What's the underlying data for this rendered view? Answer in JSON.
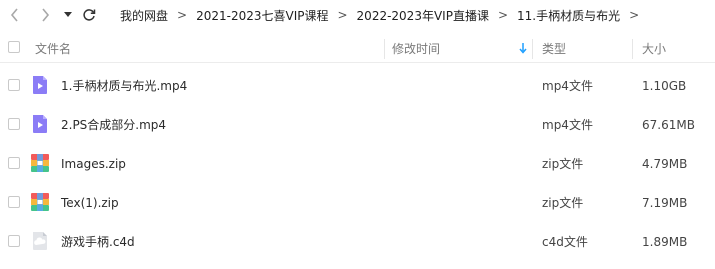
{
  "toolbar": {
    "breadcrumb": [
      "我的网盘",
      "2021-2023七喜VIP课程",
      "2022-2023年VIP直播课",
      "11.手柄材质与布光"
    ],
    "separator": ">"
  },
  "table": {
    "headers": {
      "name": "文件名",
      "modified": "修改时间",
      "type": "类型",
      "size": "大小"
    },
    "rows": [
      {
        "name": "1.手柄材质与布光.mp4",
        "type": "mp4文件",
        "size": "1.10GB",
        "icon": "video-file-icon"
      },
      {
        "name": "2.PS合成部分.mp4",
        "type": "mp4文件",
        "size": "67.61MB",
        "icon": "video-file-icon"
      },
      {
        "name": "Images.zip",
        "type": "zip文件",
        "size": "4.79MB",
        "icon": "zip-archive-icon"
      },
      {
        "name": "Tex(1).zip",
        "type": "zip文件",
        "size": "7.19MB",
        "icon": "zip-archive-icon"
      },
      {
        "name": "游戏手柄.c4d",
        "type": "c4d文件",
        "size": "1.89MB",
        "icon": "generic-file-icon"
      }
    ]
  },
  "colors": {
    "video_icon": "#8b7cf6",
    "zip_icon_top": "#f25a5a",
    "zip_icon_mid": "#f5b83d",
    "zip_icon_bottom": "#45c48b",
    "sort_arrow": "#1e9fff"
  }
}
